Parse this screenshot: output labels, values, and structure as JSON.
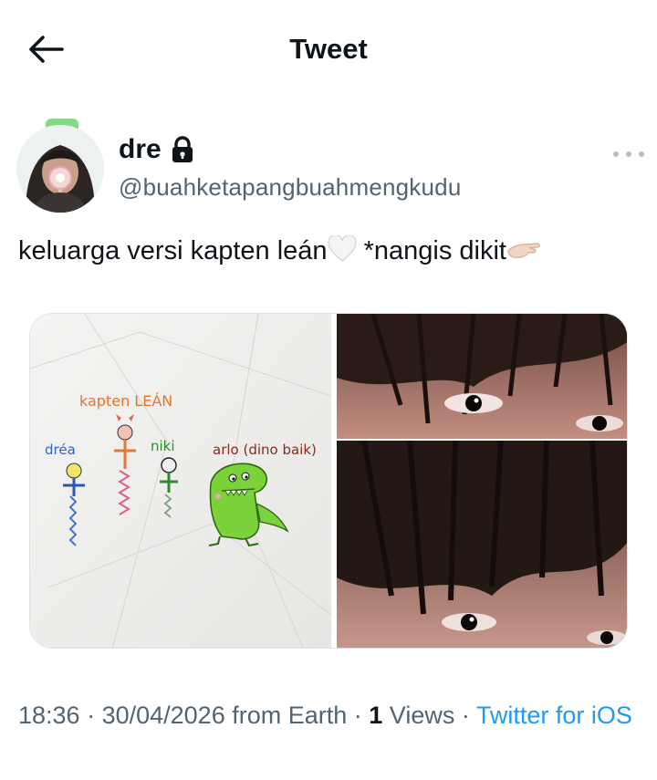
{
  "header": {
    "back_icon": "arrow-left-icon",
    "title": "Tweet"
  },
  "author": {
    "display_name": "dre",
    "lock_icon": "lock-icon",
    "handle": "@buahketapangbuahmengkudu",
    "more_icon": "more-horizontal-icon"
  },
  "tweet": {
    "text_before": "keluarga versi kapten leán",
    "text_middle": " *nangis dikit",
    "emoji_1": "🤍",
    "emoji_2": "🫷🏻"
  },
  "media": {
    "drawing_labels": {
      "kapten": "kapten LEÁN",
      "drea": "dréa",
      "niki": "niki",
      "arlo": "arlo (dino baik)"
    }
  },
  "meta": {
    "time": "18:36",
    "sep1": " · ",
    "date": "30/04/2026",
    "location": " from Earth",
    "sep2": " · ",
    "views_count": "1",
    "views_label": " Views",
    "sep3": " · ",
    "client": "Twitter for iOS"
  },
  "colors": {
    "link": "#1d9bf0",
    "secondary_text": "#536471",
    "primary_text": "#0f1419"
  }
}
